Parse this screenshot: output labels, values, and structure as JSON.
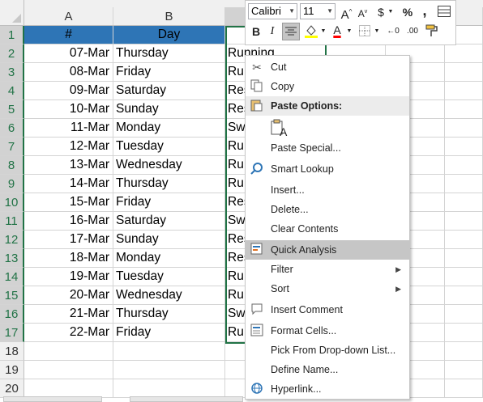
{
  "columns": [
    "A",
    "B"
  ],
  "rows": [
    "1",
    "2",
    "3",
    "4",
    "5",
    "6",
    "7",
    "8",
    "9",
    "10",
    "11",
    "12",
    "13",
    "14",
    "15",
    "16",
    "17",
    "18",
    "19",
    "20"
  ],
  "header": {
    "col_a": "#",
    "col_b": "Day"
  },
  "data": [
    {
      "date": "07-Mar",
      "day": "Thursday",
      "c": "Running"
    },
    {
      "date": "08-Mar",
      "day": "Friday",
      "c": "Ru"
    },
    {
      "date": "09-Mar",
      "day": "Saturday",
      "c": "Res"
    },
    {
      "date": "10-Mar",
      "day": "Sunday",
      "c": "Res"
    },
    {
      "date": "11-Mar",
      "day": "Monday",
      "c": "Sw"
    },
    {
      "date": "12-Mar",
      "day": "Tuesday",
      "c": "Ru"
    },
    {
      "date": "13-Mar",
      "day": "Wednesday",
      "c": "Ru"
    },
    {
      "date": "14-Mar",
      "day": "Thursday",
      "c": "Ru"
    },
    {
      "date": "15-Mar",
      "day": "Friday",
      "c": "Res"
    },
    {
      "date": "16-Mar",
      "day": "Saturday",
      "c": "Sw"
    },
    {
      "date": "17-Mar",
      "day": "Sunday",
      "c": "Res"
    },
    {
      "date": "18-Mar",
      "day": "Monday",
      "c": "Res"
    },
    {
      "date": "19-Mar",
      "day": "Tuesday",
      "c": "Ru"
    },
    {
      "date": "20-Mar",
      "day": "Wednesday",
      "c": "Ru"
    },
    {
      "date": "21-Mar",
      "day": "Thursday",
      "c": "Sw"
    },
    {
      "date": "22-Mar",
      "day": "Friday",
      "c": "Ru"
    }
  ],
  "mini_toolbar": {
    "font_name": "Calibri",
    "font_size": "11",
    "grow_font": "A",
    "shrink_font": "A",
    "currency": "$",
    "percent": "%",
    "comma": ",",
    "bold": "B",
    "italic": "I",
    "font_color_letter": "A",
    "dec_inc": "←0",
    "dec_dec": ".00"
  },
  "context_menu": {
    "cut": "Cut",
    "copy": "Copy",
    "paste_options": "Paste Options:",
    "paste_icon_letter": "A",
    "paste_special": "Paste Special...",
    "smart_lookup": "Smart Lookup",
    "insert": "Insert...",
    "delete": "Delete...",
    "clear_contents": "Clear Contents",
    "quick_analysis": "Quick Analysis",
    "filter": "Filter",
    "sort": "Sort",
    "insert_comment": "Insert Comment",
    "format_cells": "Format Cells...",
    "pick_from_list": "Pick From Drop-down List...",
    "define_name": "Define Name...",
    "hyperlink": "Hyperlink..."
  },
  "colors": {
    "header_fill": "#2e75b6",
    "selection": "#217346",
    "menu_highlight": "#c6c6c6"
  }
}
